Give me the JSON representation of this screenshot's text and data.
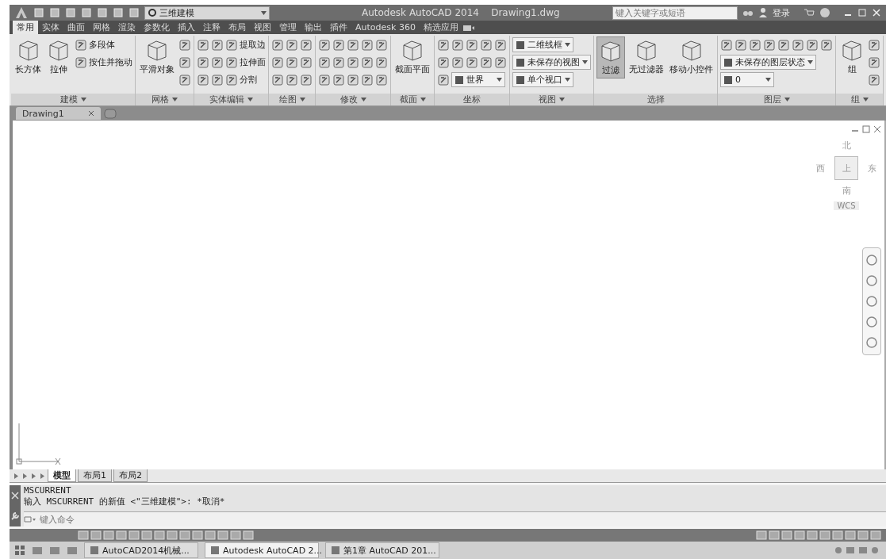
{
  "title_bar": {
    "workspace": "三维建模",
    "title": "Autodesk AutoCAD 2014    Drawing1.dwg",
    "search": {
      "placeholder": "键入关键字或短语"
    },
    "sign_in": "登录"
  },
  "ribbon_tabs": [
    {
      "label": "常用",
      "selected": true
    },
    {
      "label": "实体",
      "selected": false
    },
    {
      "label": "曲面",
      "selected": false
    },
    {
      "label": "网格",
      "selected": false
    },
    {
      "label": "渲染",
      "selected": false
    },
    {
      "label": "参数化",
      "selected": false
    },
    {
      "label": "插入",
      "selected": false
    },
    {
      "label": "注释",
      "selected": false
    },
    {
      "label": "布局",
      "selected": false
    },
    {
      "label": "视图",
      "selected": false
    },
    {
      "label": "管理",
      "selected": false
    },
    {
      "label": "输出",
      "selected": false
    },
    {
      "label": "插件",
      "selected": false
    },
    {
      "label": "Autodesk 360",
      "selected": false
    },
    {
      "label": "精选应用",
      "selected": false
    }
  ],
  "panels": [
    {
      "title": "建模",
      "has_menu": true,
      "items": [
        {
          "kind": "large",
          "label": "长方体"
        },
        {
          "kind": "large",
          "label": "拉伸"
        },
        {
          "kind": "stack",
          "rows": [
            [
              {
                "kind": "labeled",
                "label": "多段体"
              }
            ],
            [
              {
                "kind": "labeled",
                "label": "按住并拖动"
              }
            ]
          ]
        }
      ]
    },
    {
      "title": "网格",
      "has_menu": true,
      "items": [
        {
          "kind": "large",
          "label": "平滑对象"
        },
        {
          "kind": "stack",
          "rows": [
            [
              {
                "kind": "icon"
              }
            ],
            [
              {
                "kind": "icon"
              }
            ],
            [
              {
                "kind": "icon"
              }
            ]
          ]
        }
      ]
    },
    {
      "title": "实体编辑",
      "has_menu": true,
      "items": [
        {
          "kind": "stack",
          "rows": [
            [
              {
                "kind": "icon"
              },
              {
                "kind": "icon"
              },
              {
                "kind": "labeled",
                "label": "提取边"
              }
            ],
            [
              {
                "kind": "icon"
              },
              {
                "kind": "icon"
              },
              {
                "kind": "labeled",
                "label": "拉伸面"
              }
            ],
            [
              {
                "kind": "icon"
              },
              {
                "kind": "icon"
              },
              {
                "kind": "labeled",
                "label": "分割"
              }
            ]
          ]
        }
      ]
    },
    {
      "title": "绘图",
      "has_menu": true,
      "items": [
        {
          "kind": "stack",
          "rows": [
            [
              {
                "kind": "icon"
              },
              {
                "kind": "icon"
              },
              {
                "kind": "icon"
              }
            ],
            [
              {
                "kind": "icon"
              },
              {
                "kind": "icon"
              },
              {
                "kind": "icon"
              }
            ],
            [
              {
                "kind": "icon"
              },
              {
                "kind": "icon"
              },
              {
                "kind": "icon"
              }
            ]
          ]
        }
      ]
    },
    {
      "title": "修改",
      "has_menu": true,
      "items": [
        {
          "kind": "stack",
          "rows": [
            [
              {
                "kind": "icon"
              },
              {
                "kind": "icon"
              },
              {
                "kind": "icon"
              },
              {
                "kind": "icon"
              },
              {
                "kind": "icon"
              }
            ],
            [
              {
                "kind": "icon"
              },
              {
                "kind": "icon"
              },
              {
                "kind": "icon"
              },
              {
                "kind": "icon"
              },
              {
                "kind": "icon"
              }
            ],
            [
              {
                "kind": "icon"
              },
              {
                "kind": "icon"
              },
              {
                "kind": "icon"
              },
              {
                "kind": "icon"
              },
              {
                "kind": "icon"
              }
            ]
          ]
        }
      ]
    },
    {
      "title": "截面",
      "has_menu": true,
      "items": [
        {
          "kind": "large",
          "label": "截面平面"
        }
      ]
    },
    {
      "title": "坐标",
      "has_menu": false,
      "items": [
        {
          "kind": "stack",
          "rows": [
            [
              {
                "kind": "icon"
              },
              {
                "kind": "icon"
              },
              {
                "kind": "icon"
              },
              {
                "kind": "icon"
              },
              {
                "kind": "icon"
              }
            ],
            [
              {
                "kind": "icon"
              },
              {
                "kind": "icon"
              },
              {
                "kind": "icon"
              },
              {
                "kind": "icon"
              },
              {
                "kind": "icon"
              }
            ],
            [
              {
                "kind": "icon"
              },
              {
                "kind": "dropdown",
                "label": "世界"
              }
            ]
          ]
        }
      ]
    },
    {
      "title": "视图",
      "has_menu": true,
      "items": [
        {
          "kind": "stack",
          "rows": [
            [
              {
                "kind": "dropdown",
                "label": "二维线框"
              }
            ],
            [
              {
                "kind": "dropdown",
                "label": "未保存的视图"
              }
            ],
            [
              {
                "kind": "dropdown",
                "label": "单个视口"
              }
            ]
          ]
        }
      ]
    },
    {
      "title": "选择",
      "has_menu": false,
      "items": [
        {
          "kind": "large",
          "label": "过滤",
          "on": true
        },
        {
          "kind": "large",
          "label": "无过滤器",
          "on": false
        },
        {
          "kind": "large",
          "label": "移动小控件",
          "on": false
        }
      ]
    },
    {
      "title": "图层",
      "has_menu": true,
      "items": [
        {
          "kind": "stack",
          "rows": [
            [
              {
                "kind": "icon"
              },
              {
                "kind": "icon"
              },
              {
                "kind": "icon"
              },
              {
                "kind": "icon"
              },
              {
                "kind": "icon"
              },
              {
                "kind": "icon"
              },
              {
                "kind": "icon"
              },
              {
                "kind": "icon"
              }
            ],
            [
              {
                "kind": "dropdown",
                "label": "未保存的图层状态"
              }
            ],
            [
              {
                "kind": "dropdown",
                "label": "0"
              }
            ]
          ]
        }
      ]
    },
    {
      "title": "组",
      "has_menu": true,
      "items": [
        {
          "kind": "large",
          "label": "组"
        },
        {
          "kind": "stack",
          "rows": [
            [
              {
                "kind": "icon"
              }
            ],
            [
              {
                "kind": "icon"
              }
            ],
            [
              {
                "kind": "icon"
              }
            ]
          ]
        }
      ]
    }
  ],
  "file_tabs": [
    {
      "label": "Drawing1",
      "selected": true
    }
  ],
  "viewcube": {
    "north": "北",
    "west": "西",
    "top": "上",
    "east": "东",
    "south": "南",
    "ucs": "WCS"
  },
  "layout_tabs": [
    {
      "label": "模型",
      "selected": true
    },
    {
      "label": "布局1",
      "selected": false
    },
    {
      "label": "布局2",
      "selected": false
    }
  ],
  "command_line": {
    "history": [
      "MSCURRENT",
      "输入 MSCURRENT 的新值 <\"三维建模\">: *取消*"
    ],
    "placeholder": "键入命令"
  },
  "taskbar": {
    "tasks": [
      {
        "label": "AutoCAD2014机械...",
        "selected": false
      },
      {
        "label": "Autodesk AutoCAD 2...",
        "selected": true
      },
      {
        "label": "第1章 AutoCAD 201...",
        "selected": false
      }
    ]
  }
}
